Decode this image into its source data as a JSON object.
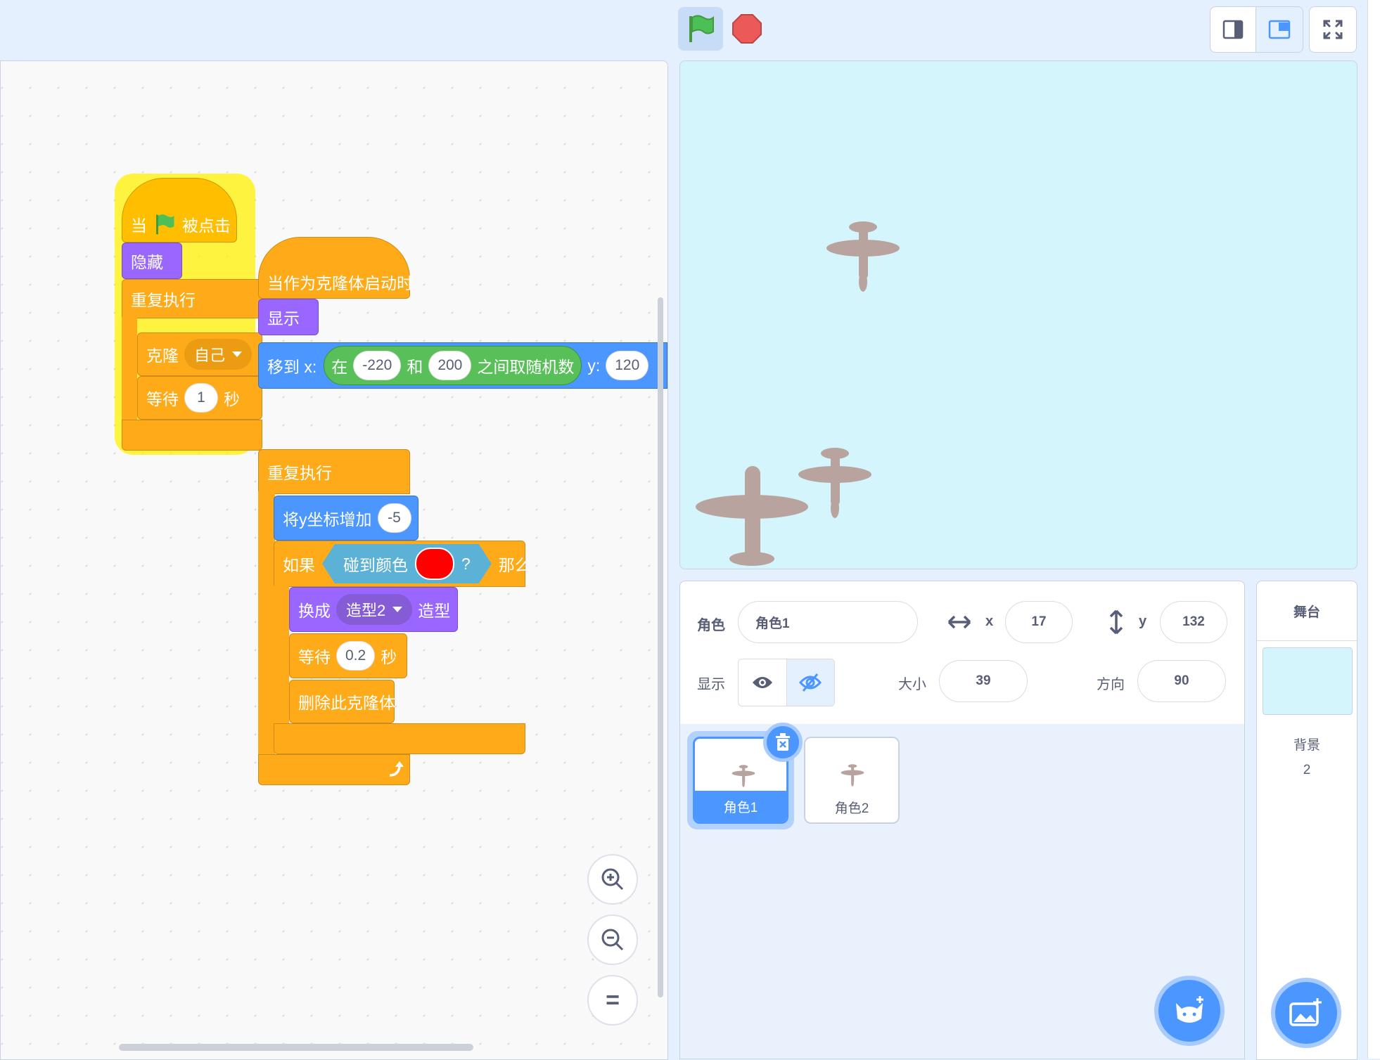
{
  "colors": {
    "events": "#ffbf00",
    "control": "#ffab19",
    "looks": "#9966ff",
    "motion": "#4c97ff",
    "operators": "#59c059",
    "sensing": "#5cb1d6",
    "touch_color": "#ff0000",
    "stage_bg": "#d3f5fb",
    "sprite_brown": "#b8a39f"
  },
  "icons": {
    "flag": "green-flag-icon",
    "stop": "stop-icon",
    "small_stage": "small-stage-icon",
    "normal_stage": "normal-stage-icon",
    "fullscreen": "fullscreen-icon"
  },
  "script1": {
    "when": "当",
    "clicked": "被点击",
    "hide": "隐藏",
    "forever": "重复执行",
    "clone": "克隆",
    "clone_target": "自己",
    "wait": "等待",
    "wait_value": "1",
    "sec": "秒"
  },
  "script2": {
    "hat": "当作为克隆体启动时",
    "show": "显示",
    "goto": "移到 x:",
    "rand_in": "在",
    "rand_from": "-220",
    "rand_and": "和",
    "rand_to": "200",
    "rand_suffix": "之间取随机数",
    "y_label": "y:",
    "y_value": "120",
    "forever": "重复执行",
    "change_y": "将y坐标增加",
    "change_y_value": "-5",
    "if": "如果",
    "touch_color": "碰到颜色",
    "q": "?",
    "then": "那么",
    "switch": "换成",
    "costume": "造型2",
    "costume_suffix": "造型",
    "wait": "等待",
    "wait_value": "0.2",
    "sec": "秒",
    "delete": "删除此克隆体"
  },
  "zoom": {
    "reset_label": "="
  },
  "sprite_info": {
    "sprite_label": "角色",
    "sprite_name": "角色1",
    "x_label": "x",
    "x_value": "17",
    "y_label": "y",
    "y_value": "132",
    "show_label": "显示",
    "size_label": "大小",
    "size_value": "39",
    "direction_label": "方向",
    "direction_value": "90"
  },
  "sprites": [
    {
      "name": "角色1",
      "selected": true
    },
    {
      "name": "角色2",
      "selected": false
    }
  ],
  "stage_panel": {
    "title": "舞台",
    "backdrops_label": "背景",
    "backdrops_count": "2"
  }
}
